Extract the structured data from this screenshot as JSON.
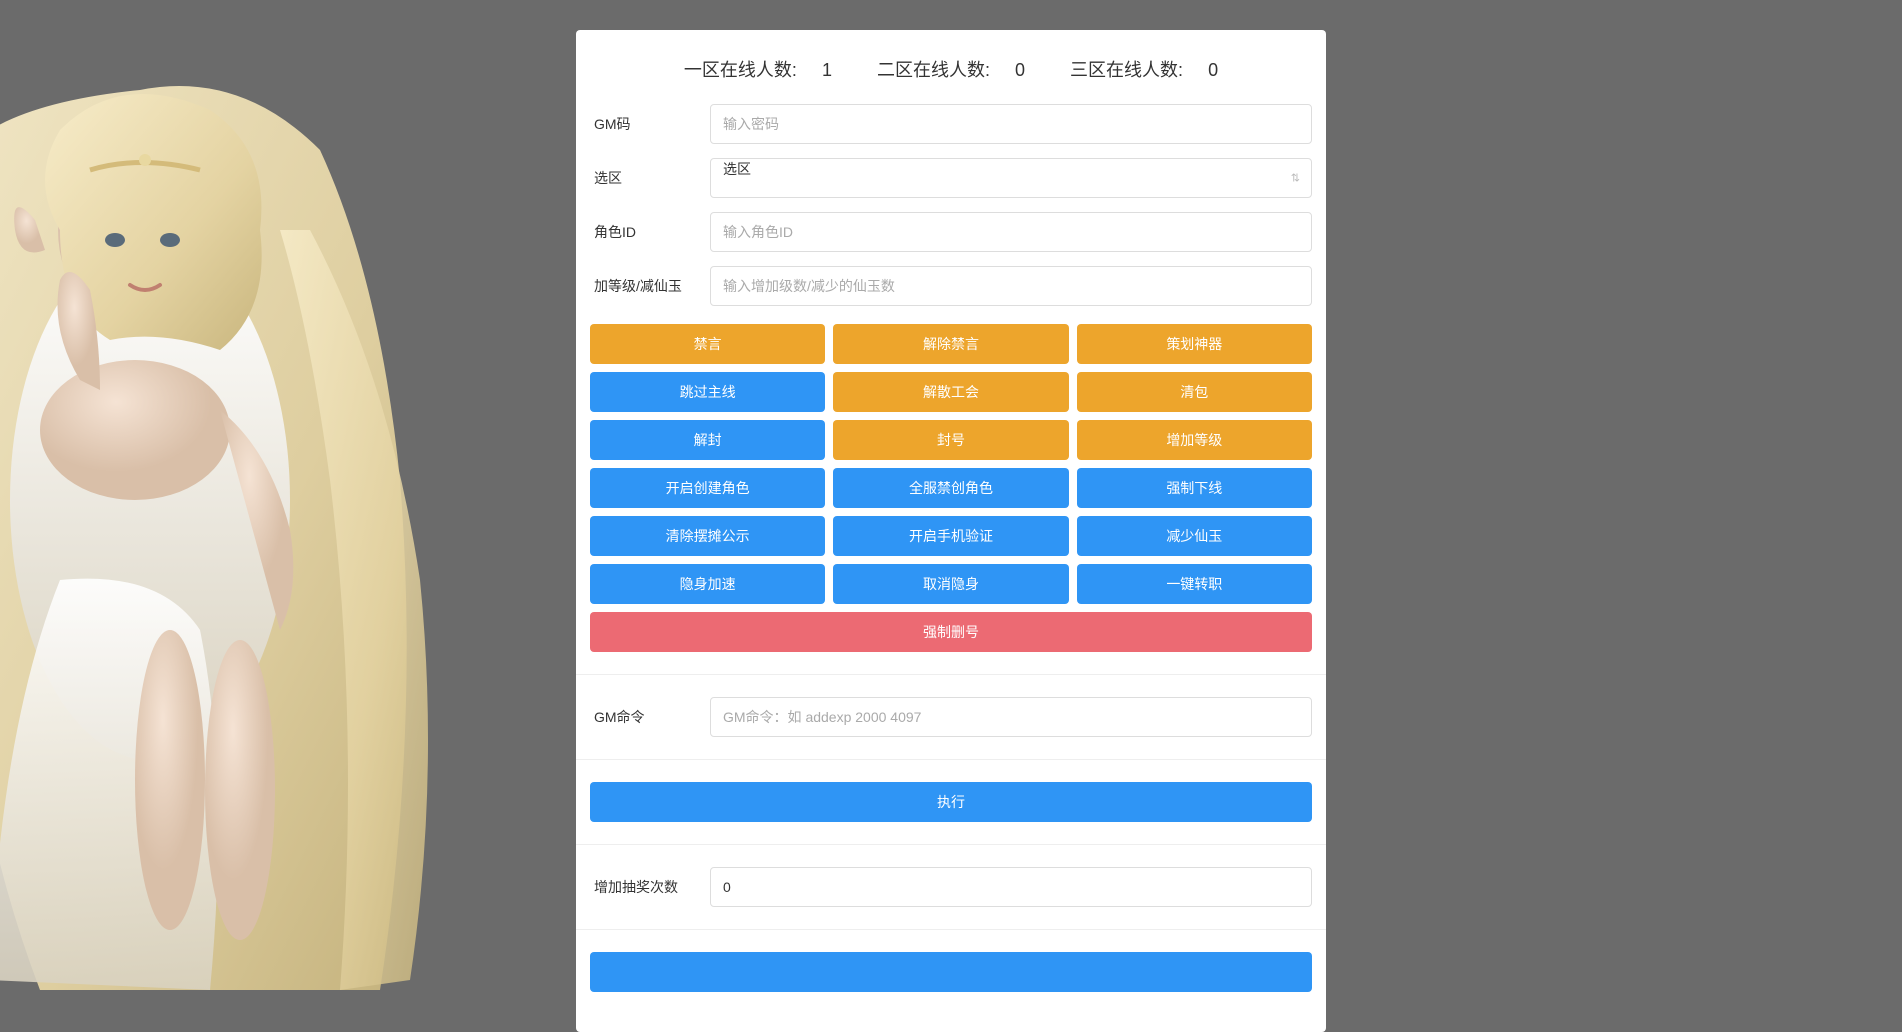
{
  "header": {
    "zone1_label": "一区在线人数:",
    "zone1_count": "1",
    "zone2_label": "二区在线人数:",
    "zone2_count": "0",
    "zone3_label": "三区在线人数:",
    "zone3_count": "0"
  },
  "fields": {
    "gm_code": {
      "label": "GM码",
      "placeholder": "输入密码"
    },
    "zone_select": {
      "label": "选区",
      "value": "选区"
    },
    "role_id": {
      "label": "角色ID",
      "placeholder": "输入角色ID"
    },
    "level_jade": {
      "label": "加等级/减仙玉",
      "placeholder": "输入增加级数/减少的仙玉数"
    },
    "gm_command": {
      "label": "GM命令",
      "placeholder": "GM命令：如 addexp 2000 4097"
    },
    "lottery_count": {
      "label": "增加抽奖次数",
      "value": "0"
    }
  },
  "buttons": {
    "row1": [
      "禁言",
      "解除禁言",
      "策划神器"
    ],
    "row2": [
      "跳过主线",
      "解散工会",
      "清包"
    ],
    "row3": [
      "解封",
      "封号",
      "增加等级"
    ],
    "row4": [
      "开启创建角色",
      "全服禁创角色",
      "强制下线"
    ],
    "row5": [
      "清除摆摊公示",
      "开启手机验证",
      "减少仙玉"
    ],
    "row6": [
      "隐身加速",
      "取消隐身",
      "一键转职"
    ],
    "force_delete": "强制删号",
    "execute": "执行"
  }
}
